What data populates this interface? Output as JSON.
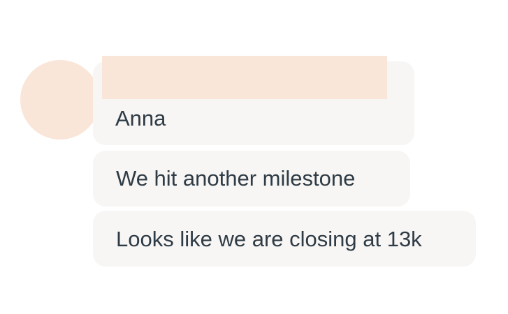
{
  "colors": {
    "avatar_fill": "#fae5d9",
    "name_placeholder_fill": "#fae5d9",
    "bubble_background": "#f7f6f4",
    "text": "#2f3b45"
  },
  "chat": {
    "sender": {
      "name": "Anna",
      "avatar_icon": "avatar-placeholder"
    },
    "messages": [
      {
        "text": "We hit another milestone"
      },
      {
        "text": "Looks like we are closing at 13k"
      }
    ]
  }
}
